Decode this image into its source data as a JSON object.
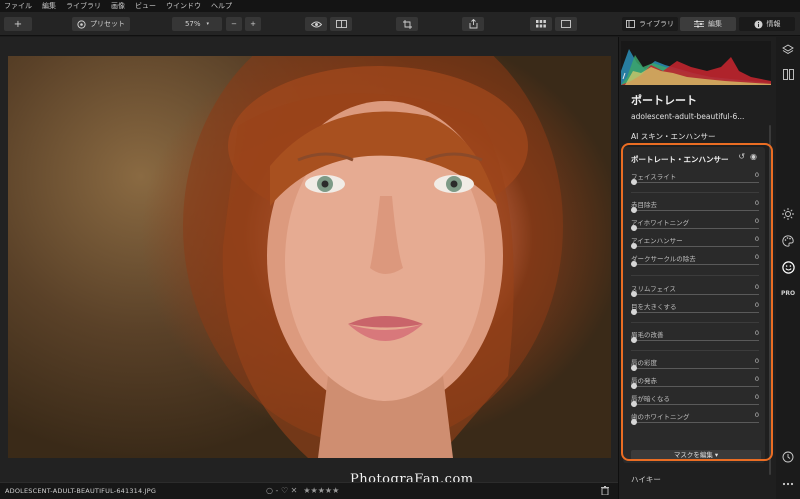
{
  "menu": [
    "ファイル",
    "編集",
    "ライブラリ",
    "画像",
    "ビュー",
    "ウインドウ",
    "ヘルプ"
  ],
  "toolbar": {
    "add_label": "+",
    "presets_label": "プリセット",
    "zoom_value": "57%",
    "zoom_minus": "−",
    "zoom_plus": "+",
    "library_tab": "ライブラリ",
    "edit_tab": "編集",
    "info_tab": "情報"
  },
  "photo": {
    "watermark": "PhotograFan.com"
  },
  "bottom": {
    "filename": "ADOLESCENT-ADULT-BEAUTIFUL-641314.JPG",
    "flag_symbols": "○ - ♡ ✕",
    "stars": "★★★★★",
    "trash_symbol": "🗑"
  },
  "panel": {
    "title": "ポートレート",
    "filename": "adolescent-adult-beautiful-6...",
    "ai_section": "AI スキン・エンハンサー",
    "enhancer": {
      "title": "ポートレート・エンハンサー",
      "undo_symbol": "↺",
      "eye_symbol": "◉",
      "sliders": [
        {
          "label": "フェイスライト",
          "value": "0"
        },
        {
          "label": "赤目除去",
          "value": "0"
        },
        {
          "label": "アイホワイトニング",
          "value": "0"
        },
        {
          "label": "アイエンハンサー",
          "value": "0"
        },
        {
          "label": "ダークサークルの除去",
          "value": "0"
        },
        {
          "label": "スリムフェイス",
          "value": "0"
        },
        {
          "label": "目を大きくする",
          "value": "0"
        },
        {
          "label": "眉毛の改善",
          "value": "0"
        },
        {
          "label": "唇の彩度",
          "value": "0"
        },
        {
          "label": "唇の発赤",
          "value": "0"
        },
        {
          "label": "唇が暗くなる",
          "value": "0"
        },
        {
          "label": "歯のホワイトニング",
          "value": "0"
        }
      ],
      "mask_button": "マスクを編集 ▾"
    },
    "next_section": "ハイキー"
  },
  "colors": {
    "highlight": "#ea6d23",
    "panel_bg": "#1f1f1f",
    "card_bg": "#2a2a2a"
  },
  "strip_icons": [
    "layers-icon",
    "compare-icon",
    "sun-icon",
    "palette-icon",
    "smiley-icon",
    "pro-icon",
    "history-icon",
    "more-icon"
  ]
}
